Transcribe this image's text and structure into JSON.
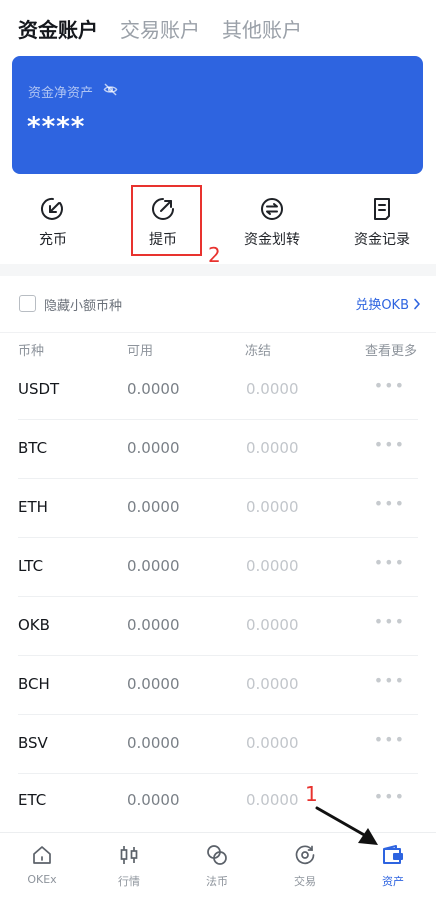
{
  "top_tabs": [
    {
      "label": "资金账户",
      "active": true
    },
    {
      "label": "交易账户",
      "active": false
    },
    {
      "label": "其他账户",
      "active": false
    }
  ],
  "asset_card": {
    "label": "资金净资产",
    "value": "****",
    "color": "#2e64e0",
    "eye_icon": "eye-off-icon"
  },
  "actions": [
    {
      "label": "充币",
      "icon": "deposit-icon"
    },
    {
      "label": "提币",
      "icon": "withdraw-icon"
    },
    {
      "label": "资金划转",
      "icon": "transfer-icon"
    },
    {
      "label": "资金记录",
      "icon": "records-icon"
    }
  ],
  "annotations": {
    "box_number": "2",
    "arrow_number": "1",
    "color": "#e8322e"
  },
  "filter": {
    "hide_small_label": "隐藏小额币种",
    "exchange_link": "兑换OKB"
  },
  "table": {
    "headers": [
      "币种",
      "可用",
      "冻结",
      "查看更多"
    ],
    "rows": [
      {
        "coin": "USDT",
        "available": "0.0000",
        "frozen": "0.0000"
      },
      {
        "coin": "BTC",
        "available": "0.0000",
        "frozen": "0.0000"
      },
      {
        "coin": "ETH",
        "available": "0.0000",
        "frozen": "0.0000"
      },
      {
        "coin": "LTC",
        "available": "0.0000",
        "frozen": "0.0000"
      },
      {
        "coin": "OKB",
        "available": "0.0000",
        "frozen": "0.0000"
      },
      {
        "coin": "BCH",
        "available": "0.0000",
        "frozen": "0.0000"
      },
      {
        "coin": "BSV",
        "available": "0.0000",
        "frozen": "0.0000"
      },
      {
        "coin": "ETC",
        "available": "0.0000",
        "frozen": "0.0000"
      }
    ],
    "more_glyph": "•••"
  },
  "bottom_nav": [
    {
      "label": "OKEx",
      "icon": "home-icon",
      "active": false
    },
    {
      "label": "行情",
      "icon": "candlestick-icon",
      "active": false
    },
    {
      "label": "法币",
      "icon": "fiat-icon",
      "active": false
    },
    {
      "label": "交易",
      "icon": "trade-icon",
      "active": false
    },
    {
      "label": "资产",
      "icon": "wallet-icon",
      "active": true
    }
  ]
}
